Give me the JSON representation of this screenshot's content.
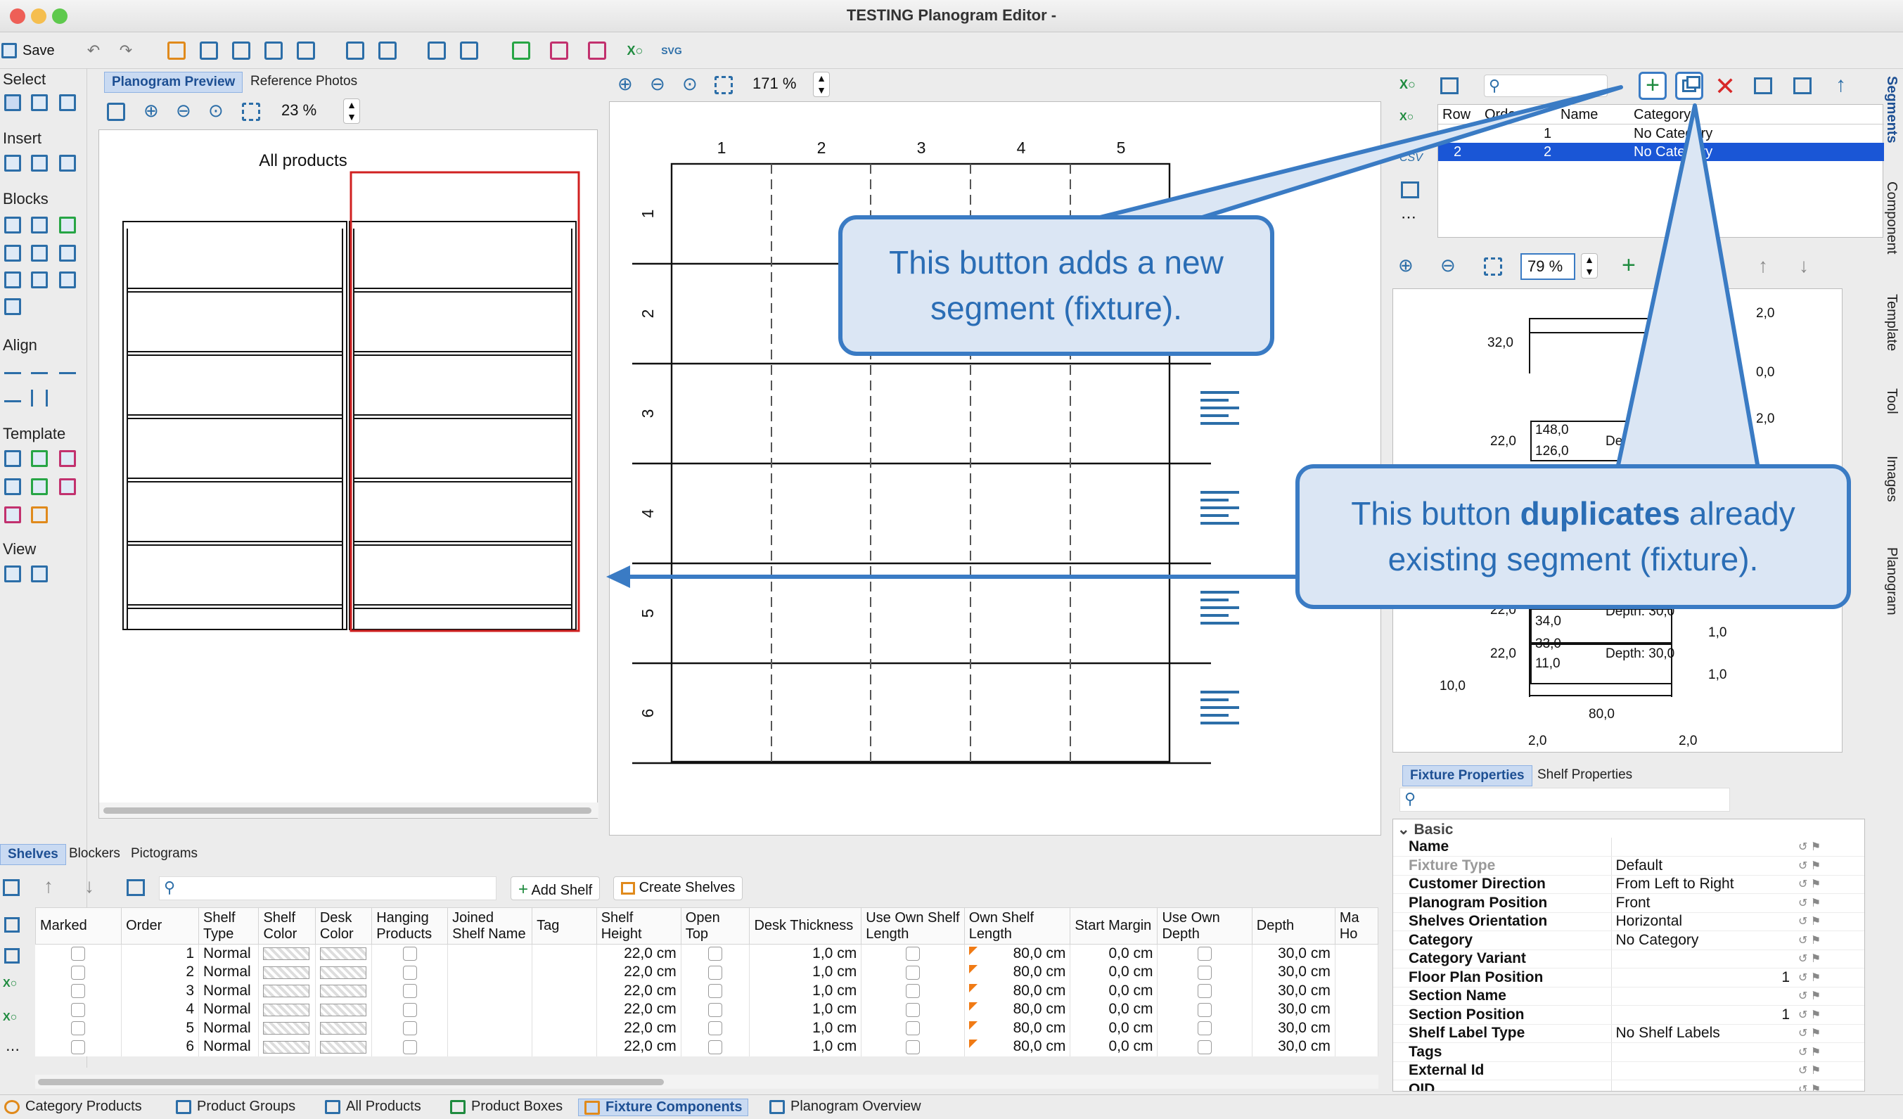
{
  "window": {
    "title": "TESTING Planogram Editor -"
  },
  "toolbar": {
    "save_label": "Save"
  },
  "left_tools": {
    "select": "Select",
    "insert": "Insert",
    "blocks": "Blocks",
    "align": "Align",
    "template": "Template",
    "view": "View"
  },
  "preview": {
    "tabs": [
      "Planogram Preview",
      "Reference Photos"
    ],
    "zoom": "23 %",
    "heading": "All products"
  },
  "editor": {
    "zoom": "171 %",
    "col_labels": [
      "1",
      "2",
      "3",
      "4",
      "5"
    ],
    "row_labels": [
      "1",
      "2",
      "3",
      "4",
      "5",
      "6"
    ]
  },
  "segments": {
    "headers": [
      "Row",
      "Order",
      "Name",
      "Category"
    ],
    "rows": [
      {
        "row": "",
        "order": "1",
        "name": "",
        "category": "No Category"
      },
      {
        "row": "2",
        "order": "2",
        "name": "",
        "category": "No Category"
      }
    ],
    "side_label": "CSV",
    "zoom": "79 %"
  },
  "fixture_drawing": {
    "dims": [
      "2,0",
      "32,0",
      "0,0",
      "2,0",
      "22,0",
      "148,0",
      "126,0",
      "De",
      "22,0",
      "34,0",
      "Depth: 30,0",
      "1,0",
      "22,0",
      "33,0",
      "11,0",
      "Depth: 30,0",
      "1,0",
      "10,0",
      "80,0",
      "2,0",
      "2,0"
    ]
  },
  "callouts": {
    "add_prefix": "This button adds a new segment (fixture).",
    "dup_pre": "This button ",
    "dup_bold": "duplicates",
    "dup_post": " already existing segment (fixture)."
  },
  "right_tabs": [
    "Segments",
    "Component",
    "Template",
    "Tool",
    "Images",
    "Planogram"
  ],
  "properties": {
    "tabs": [
      "Fixture Properties",
      "Shelf Properties"
    ],
    "group": "Basic",
    "rows": [
      {
        "name": "Name",
        "value": ""
      },
      {
        "name": "Fixture Type",
        "value": "Default"
      },
      {
        "name": "Customer Direction",
        "value": "From Left to Right"
      },
      {
        "name": "Planogram Position",
        "value": "Front"
      },
      {
        "name": "Shelves Orientation",
        "value": "Horizontal"
      },
      {
        "name": "Category",
        "value": "No Category"
      },
      {
        "name": "Category Variant",
        "value": ""
      },
      {
        "name": "Floor Plan Position",
        "value": "1"
      },
      {
        "name": "Section Name",
        "value": ""
      },
      {
        "name": "Section Position",
        "value": "1"
      },
      {
        "name": "Shelf Label Type",
        "value": "No Shelf Labels"
      },
      {
        "name": "Tags",
        "value": ""
      },
      {
        "name": "External Id",
        "value": ""
      },
      {
        "name": "OID",
        "value": ""
      }
    ]
  },
  "shelves_panel": {
    "tabs": [
      "Shelves",
      "Blockers",
      "Pictograms"
    ],
    "add_shelf": "Add Shelf",
    "create_shelves": "Create Shelves",
    "headers": [
      "Marked",
      "Order",
      "Shelf Type",
      "Shelf Color",
      "Desk Color",
      "Hanging Products",
      "Joined Shelf Name",
      "Tag",
      "Shelf Height",
      "Open Top",
      "Desk Thickness",
      "Use Own Shelf Length",
      "Own Shelf Length",
      "Start Margin",
      "Use Own Depth",
      "Depth",
      "Ma Ho"
    ],
    "rows": [
      {
        "order": "1",
        "type": "Normal",
        "height": "22,0 cm",
        "thick": "1,0 cm",
        "length": "80,0 cm",
        "margin": "0,0 cm",
        "depth": "30,0 cm"
      },
      {
        "order": "2",
        "type": "Normal",
        "height": "22,0 cm",
        "thick": "1,0 cm",
        "length": "80,0 cm",
        "margin": "0,0 cm",
        "depth": "30,0 cm"
      },
      {
        "order": "3",
        "type": "Normal",
        "height": "22,0 cm",
        "thick": "1,0 cm",
        "length": "80,0 cm",
        "margin": "0,0 cm",
        "depth": "30,0 cm"
      },
      {
        "order": "4",
        "type": "Normal",
        "height": "22,0 cm",
        "thick": "1,0 cm",
        "length": "80,0 cm",
        "margin": "0,0 cm",
        "depth": "30,0 cm"
      },
      {
        "order": "5",
        "type": "Normal",
        "height": "22,0 cm",
        "thick": "1,0 cm",
        "length": "80,0 cm",
        "margin": "0,0 cm",
        "depth": "30,0 cm"
      },
      {
        "order": "6",
        "type": "Normal",
        "height": "22,0 cm",
        "thick": "1,0 cm",
        "length": "80,0 cm",
        "margin": "0,0 cm",
        "depth": "30,0 cm"
      }
    ]
  },
  "bottom_tabs": [
    "Category Products",
    "Product Groups",
    "All Products",
    "Product Boxes",
    "Fixture Components",
    "Planogram Overview"
  ],
  "colors": {
    "accent": "#3a7bc4",
    "selection": "#1a56d6",
    "red_frame": "#d02020",
    "callout_bg": "#dbe6f4"
  }
}
